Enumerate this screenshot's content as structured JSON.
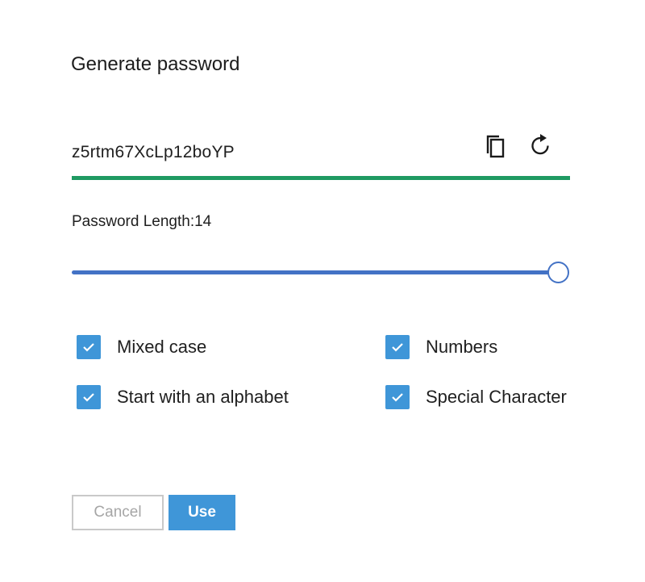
{
  "dialog": {
    "title": "Generate password"
  },
  "password": {
    "value": "z5rtm67XcLp12boYP",
    "strength_color": "#1f9a62",
    "copy_icon": "copy-icon",
    "refresh_icon": "refresh-icon"
  },
  "length": {
    "label": "Password Length:14",
    "slider_fraction": 1.0,
    "track_color": "#4372c5"
  },
  "options": {
    "mixed_case": {
      "label": "Mixed case",
      "checked": true
    },
    "numbers": {
      "label": "Numbers",
      "checked": true
    },
    "start_alpha": {
      "label": "Start with an alphabet",
      "checked": true
    },
    "special_char": {
      "label": "Special Character",
      "checked": true
    },
    "checkbox_color": "#3f96d8"
  },
  "actions": {
    "cancel_label": "Cancel",
    "use_label": "Use",
    "accent_color": "#3f96d8"
  }
}
